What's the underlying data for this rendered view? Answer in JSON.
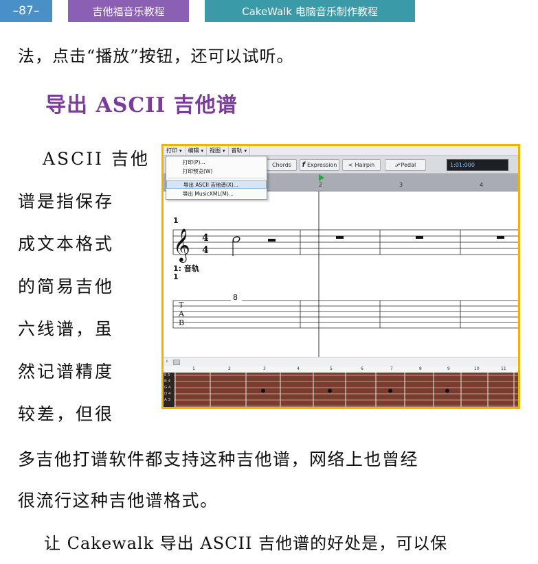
{
  "header": {
    "page_number": "–87–",
    "book_title": "吉他福音乐教程",
    "series_title": "CakeWalk 电脑音乐制作教程"
  },
  "paragraphs": {
    "intro_tail": "法，点击“播放”按钮，还可以试听。",
    "section_heading": "导出 ASCII 吉他谱",
    "side_lines": [
      "ASCII 吉他",
      "谱是指保存",
      "成文本格式",
      "的简易吉他",
      "六线谱，虽",
      "然记谱精度",
      "较差，但很"
    ],
    "continuation_line1": "多吉他打谱软件都支持这种吉他谱，网络上也曾经",
    "continuation_line2": "很流行这种吉他谱格式。",
    "last_line": "让 Cakewalk 导出 ASCII 吉他谱的好处是，可以保"
  },
  "screenshot": {
    "menus": [
      "打印",
      "编辑",
      "视图",
      "音轨"
    ],
    "dropdown_items": [
      "打印(P)...",
      "打印预览(W)",
      "导出 ASCII 吉他谱(X)...",
      "导出 MusicXML(M)..."
    ],
    "toolbar_buttons": {
      "chords": "Chords",
      "expression": "Expression",
      "hairpin": "Hairpin",
      "pedal": "Pedal"
    },
    "time_display": "1:01:000",
    "ruler_marks": [
      "2",
      "3",
      "4"
    ],
    "measure_number": "1",
    "track_label": "1: 音轨",
    "track_number": "1",
    "tab_fret": "8",
    "tab_letters": [
      "T",
      "A",
      "B"
    ],
    "fret_numbers": [
      "1",
      "2",
      "3",
      "4",
      "5",
      "6",
      "7",
      "8",
      "9",
      "10",
      "11"
    ],
    "string_labels": [
      "E 5",
      "B 4",
      "G 4",
      "D 4",
      "A 3"
    ]
  },
  "colors": {
    "heading_purple": "#7a3d9a",
    "page_tab_blue": "#4a90c8",
    "book_tab_purple": "#8a5fb4",
    "series_tab_teal": "#3b9aa8",
    "frame_border": "#f0b400"
  }
}
